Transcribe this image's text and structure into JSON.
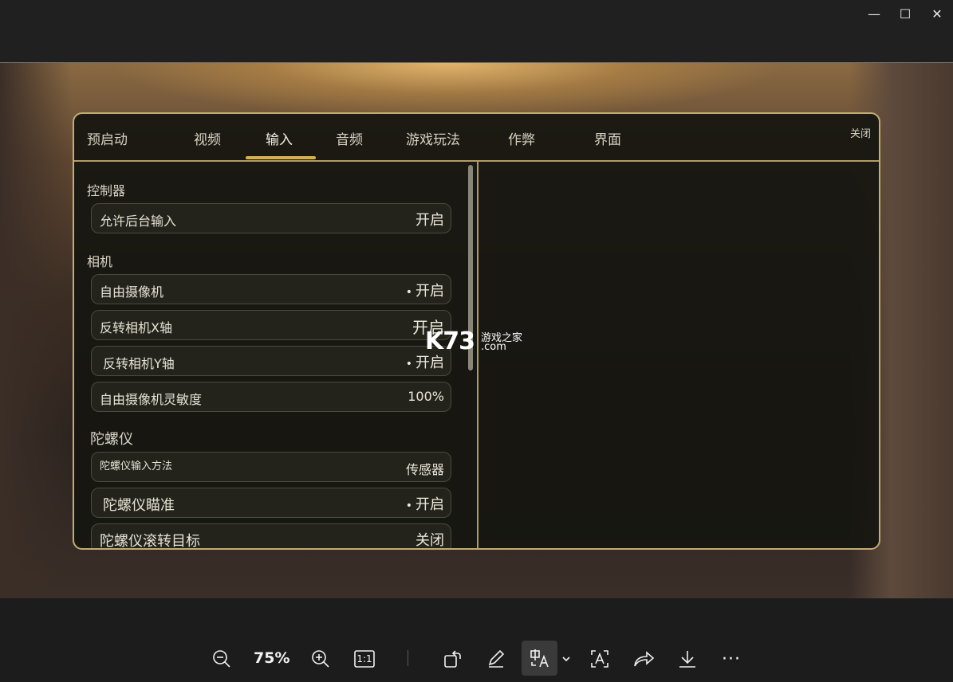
{
  "window": {
    "minimize_glyph": "—",
    "maximize_glyph": "☐",
    "close_glyph": "✕"
  },
  "settings": {
    "tabs": [
      "预启动",
      "视频",
      "输入",
      "音频",
      "游戏玩法",
      "作弊",
      "界面"
    ],
    "active_tab": "输入",
    "close_label": "关闭",
    "sections": {
      "controller": "控制器",
      "camera": "相机",
      "gyro": "陀螺仪"
    },
    "rows": [
      {
        "label": "允许后台输入",
        "value": "开启"
      },
      {
        "label": "自由摄像机",
        "value": "开启",
        "dot": "•"
      },
      {
        "label": "反转相机X轴",
        "value": "开启"
      },
      {
        "label": "反转相机Y轴",
        "value": "开启",
        "dot": "•"
      },
      {
        "label": "自由摄像机灵敏度",
        "value": "100%"
      },
      {
        "label": "陀螺仪输入方法",
        "value": "传感器"
      },
      {
        "label": "陀螺仪瞄准",
        "value": "开启",
        "dot": "•"
      },
      {
        "label": "陀螺仪滚转目标",
        "value": "关闭"
      }
    ]
  },
  "watermark": {
    "brand": "K73",
    "site_cn": "游戏之家",
    "domain": ".com"
  },
  "toolbar": {
    "zoom": "75%",
    "icons": [
      "zoom-out-icon",
      "zoom-in-icon",
      "actual-size-icon",
      "rotate-icon",
      "edit-icon",
      "text-translate-icon",
      "chevron-down-icon",
      "ocr-text-icon",
      "share-icon",
      "download-icon",
      "more-icon"
    ],
    "actual_size_label": "1:1",
    "more_glyph": "···"
  }
}
